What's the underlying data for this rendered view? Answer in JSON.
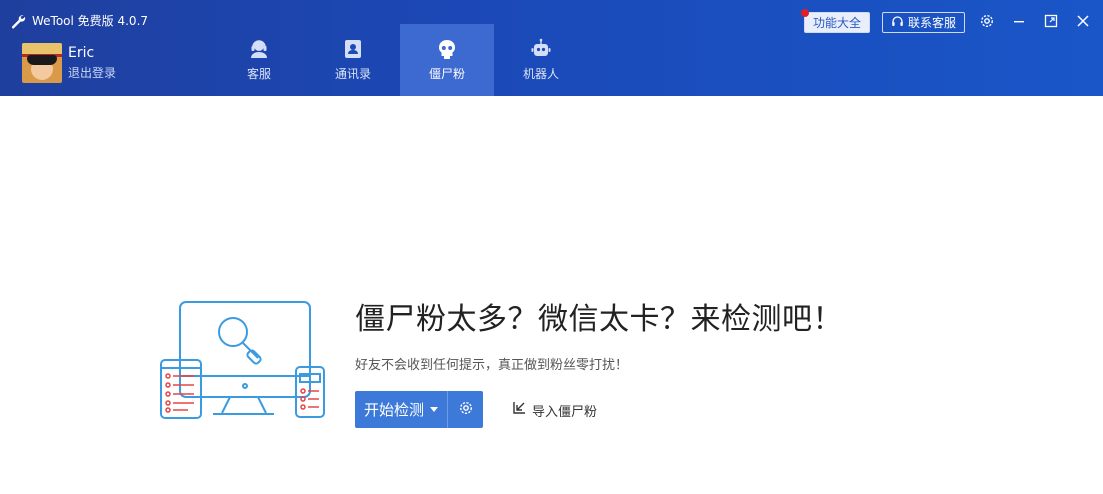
{
  "window": {
    "title": "WeTool 免费版 4.0.7"
  },
  "user": {
    "name": "Eric",
    "logout_label": "退出登录"
  },
  "nav": {
    "items": [
      {
        "label": "客服",
        "icon": "headset-icon"
      },
      {
        "label": "通讯录",
        "icon": "contact-card-icon"
      },
      {
        "label": "僵尸粉",
        "icon": "skull-icon",
        "active": true
      },
      {
        "label": "机器人",
        "icon": "robot-icon"
      }
    ]
  },
  "top_right": {
    "features_label": "功能大全",
    "support_label": "联系客服"
  },
  "hero": {
    "title": "僵尸粉太多？微信太卡？来检测吧！",
    "subtitle": "好友不会收到任何提示，真正做到粉丝零打扰！",
    "start_label": "开始检测",
    "import_label": "导入僵尸粉"
  },
  "colors": {
    "header": "#1b49b8",
    "accent": "#3d79d9",
    "active_tab": "#3c6ad0",
    "badge": "#e11d2a"
  }
}
